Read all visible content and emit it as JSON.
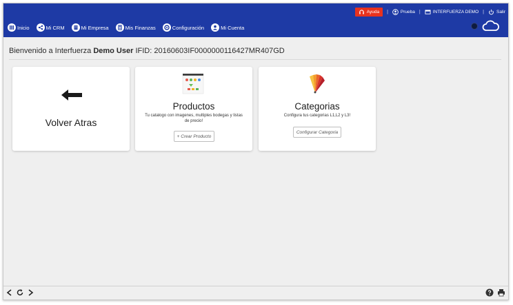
{
  "header": {
    "help_label": "Ayuda",
    "user_label": "Prueba",
    "company_label": "INTERFUERZA DEMO",
    "logout_label": "Salir",
    "separator": "|",
    "nav": [
      {
        "label": "Inicio",
        "icon": "grid-icon"
      },
      {
        "label": "Mi CRM",
        "icon": "share-icon"
      },
      {
        "label": "Mi Empresa",
        "icon": "building-icon"
      },
      {
        "label": "Mis Finanzas",
        "icon": "calculator-icon"
      },
      {
        "label": "Configuración",
        "icon": "gear-icon"
      },
      {
        "label": "Mi Cuenta",
        "icon": "user-icon"
      }
    ]
  },
  "welcome": {
    "prefix": "Bienvenido a Interfuerza",
    "user": "Demo User",
    "ifid": "IFID: 20160603IF0000000116427MR407GD"
  },
  "cards": {
    "back": {
      "title": "Volver Atras"
    },
    "products": {
      "title": "Productos",
      "description": "Tu catalogo con imagenes, multiples bodegas y listas de precio!",
      "button": "+ Crear Producto"
    },
    "categories": {
      "title": "Categorias",
      "description": "Configura tus categorias L1,L2 y L3!",
      "button": "Configurar Categoria"
    }
  },
  "colors": {
    "header_bg": "#1e3aa5",
    "help_bg": "#e8321e",
    "page_bg": "#efefef"
  }
}
